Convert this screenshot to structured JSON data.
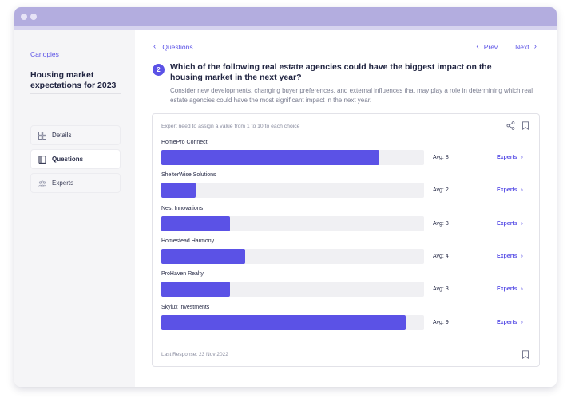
{
  "sidebar": {
    "brand": "Canopies",
    "title": "Housing market expectations for 2023",
    "items": [
      {
        "label": "Details",
        "icon": "grid-icon"
      },
      {
        "label": "Questions",
        "icon": "book-icon"
      },
      {
        "label": "Experts",
        "icon": "people-icon"
      }
    ]
  },
  "nav": {
    "back_label": "Questions",
    "prev_label": "Prev",
    "next_label": "Next"
  },
  "question": {
    "number": "2",
    "title": "Which of the following real estate agencies could have the biggest impact on the housing market in the next year?",
    "description": "Consider new developments, changing buyer preferences, and external influences that may play a role in determining which real estate agencies could have the most significant impact in the next year."
  },
  "card": {
    "hint": "Expert need to assign a value from 1 to 10 to each choice",
    "experts_label": "Experts",
    "last_response": "Last Response: 23 Nov 2022",
    "max_value": 10,
    "choices": [
      {
        "name": "HomePro Connect",
        "avg_label": "Avg: 8",
        "value": 8.3
      },
      {
        "name": "ShelterWise Solutions",
        "avg_label": "Avg: 2",
        "value": 1.3
      },
      {
        "name": "Nest Innovations",
        "avg_label": "Avg: 3",
        "value": 2.6
      },
      {
        "name": "Homestead Harmony",
        "avg_label": "Avg: 4",
        "value": 3.2
      },
      {
        "name": "ProHaven Realty",
        "avg_label": "Avg: 3",
        "value": 2.6
      },
      {
        "name": "Skylux Investments",
        "avg_label": "Avg: 9",
        "value": 9.3
      }
    ]
  },
  "colors": {
    "accent": "#5b52e6",
    "titlebar": "#b3addf",
    "track": "#f0f0f3"
  }
}
